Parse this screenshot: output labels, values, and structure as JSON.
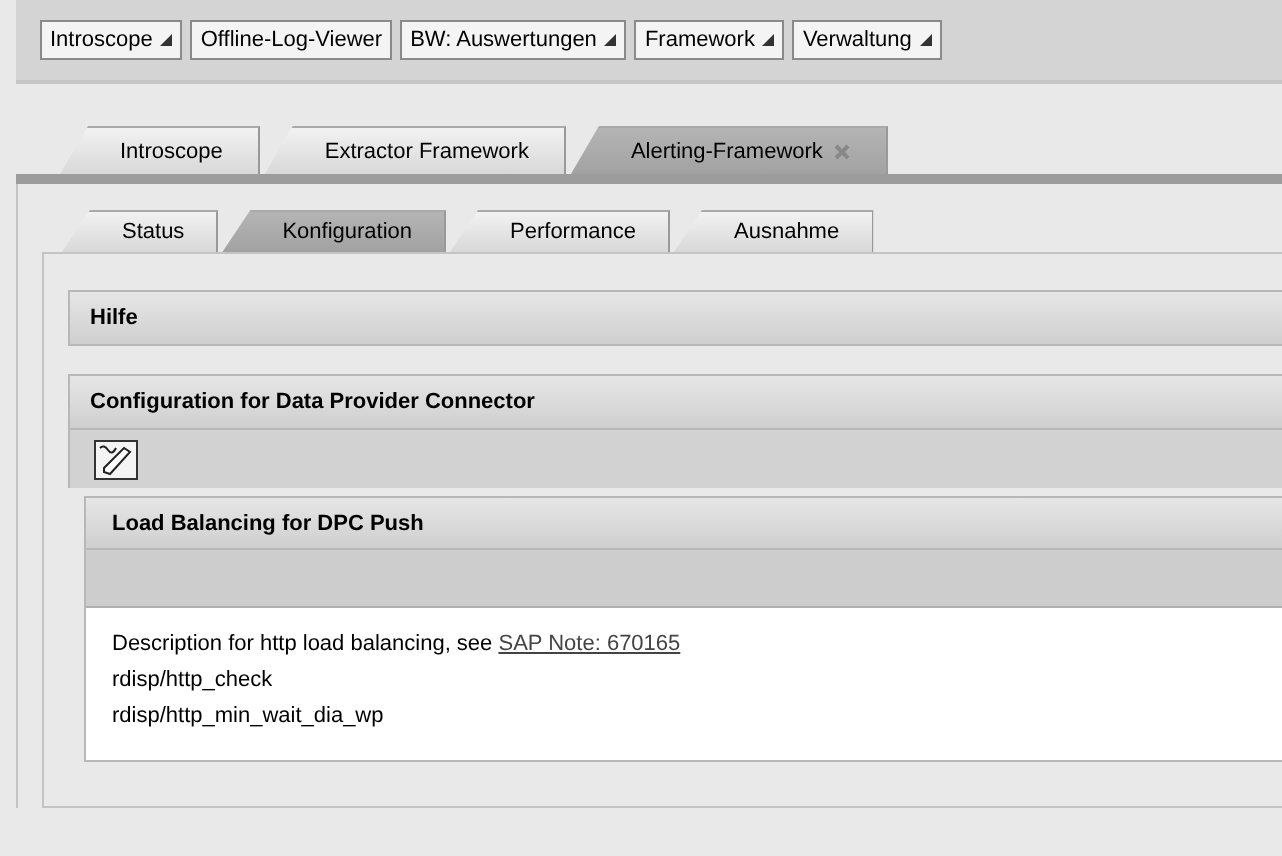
{
  "menu_bar": [
    {
      "label": "Introscope",
      "has_menu": true
    },
    {
      "label": "Offline-Log-Viewer",
      "has_menu": false
    },
    {
      "label": "BW: Auswertungen",
      "has_menu": true
    },
    {
      "label": "Framework",
      "has_menu": true
    },
    {
      "label": "Verwaltung",
      "has_menu": true
    }
  ],
  "tabs": [
    {
      "label": "Introscope",
      "selected": false,
      "closable": false
    },
    {
      "label": "Extractor Framework",
      "selected": false,
      "closable": false
    },
    {
      "label": "Alerting-Framework",
      "selected": true,
      "closable": true
    }
  ],
  "sub_tabs": [
    {
      "label": "Status",
      "selected": false
    },
    {
      "label": "Konfiguration",
      "selected": true
    },
    {
      "label": "Performance",
      "selected": false
    },
    {
      "label": "Ausnahme",
      "selected": false
    }
  ],
  "help_panel": {
    "title": "Hilfe"
  },
  "config_panel": {
    "title": "Configuration for Data Provider Connector",
    "section": {
      "title": "Load Balancing for DPC Push",
      "description": {
        "text": "Description for http load balancing, see",
        "link": "SAP Note: 670165"
      },
      "lines": [
        "rdisp/http_check",
        "rdisp/http_min_wait_dia_wp"
      ]
    }
  }
}
